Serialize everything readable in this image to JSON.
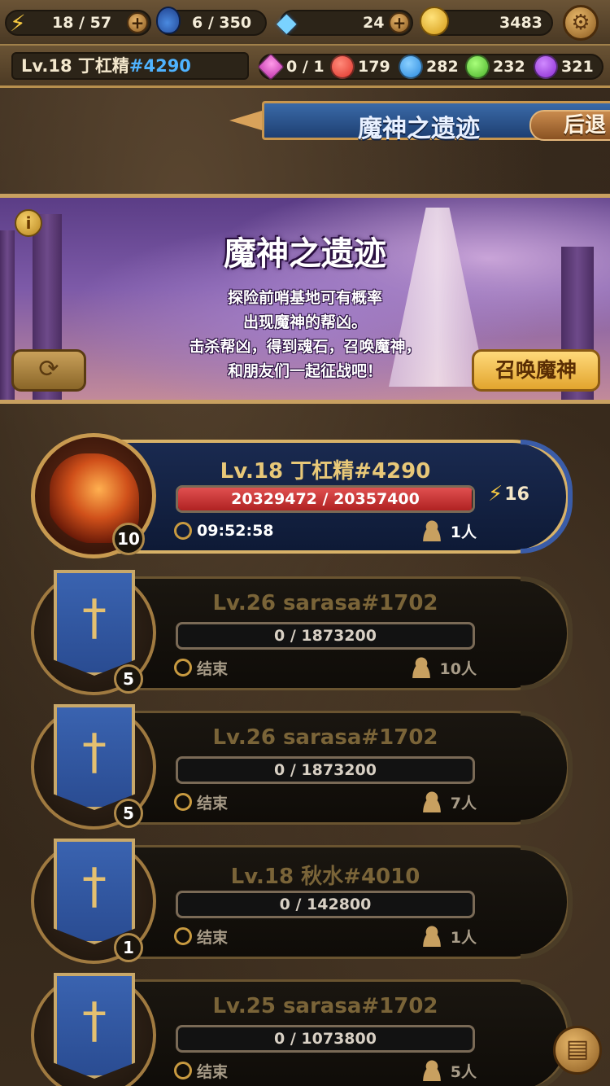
{
  "resources": {
    "energy": "18 / 57",
    "potion": "6 / 350",
    "diamonds": "24",
    "gold": "3483"
  },
  "player": {
    "name": "Lv.18 丁杠精",
    "tag": "#4290"
  },
  "gems": [
    {
      "icon": "pink-crystal-icon",
      "color": "#c43ab0",
      "value": "0 / 1"
    },
    {
      "icon": "red-orb-icon",
      "color": "#e0352b",
      "value": "179"
    },
    {
      "icon": "blue-orb-icon",
      "color": "#2a8ae0",
      "value": "282"
    },
    {
      "icon": "green-orb-icon",
      "color": "#4ab02a",
      "value": "232"
    },
    {
      "icon": "purple-orb-icon",
      "color": "#8a2ad0",
      "value": "321"
    }
  ],
  "header": {
    "title": "魔神之遗迹",
    "back_label": "后退"
  },
  "event": {
    "title": "魔神之遗迹",
    "desc_line1": "探险前哨基地可有概率",
    "desc_line2": "出现魔神的帮凶。",
    "desc_line3": "击杀帮凶，得到魂石，召唤魔神，",
    "desc_line4": "和朋友们一起征战吧！",
    "info_label": "i",
    "summon_label": "召唤魔神"
  },
  "bosses": [
    {
      "name": "Lv.18 丁杠精",
      "tag": "#4290",
      "hp": "20329472 / 20357400",
      "hp_fraction": 0.9986,
      "timer": "09:52:58",
      "players": "1人",
      "cost": "16",
      "level": "10",
      "active": true
    },
    {
      "name": "Lv.26 sarasa",
      "tag": "#1702",
      "hp": "0 / 1873200",
      "hp_fraction": 0,
      "timer": "结束",
      "players": "10人",
      "level": "5",
      "active": false
    },
    {
      "name": "Lv.26 sarasa",
      "tag": "#1702",
      "hp": "0 / 1873200",
      "hp_fraction": 0,
      "timer": "结束",
      "players": "7人",
      "level": "5",
      "active": false
    },
    {
      "name": "Lv.18 秋水",
      "tag": "#4010",
      "hp": "0 / 142800",
      "hp_fraction": 0,
      "timer": "结束",
      "players": "1人",
      "level": "1",
      "active": false
    },
    {
      "name": "Lv.25 sarasa",
      "tag": "#1702",
      "hp": "0 / 1073800",
      "hp_fraction": 0,
      "timer": "结束",
      "players": "5人",
      "level": "",
      "active": false
    }
  ]
}
